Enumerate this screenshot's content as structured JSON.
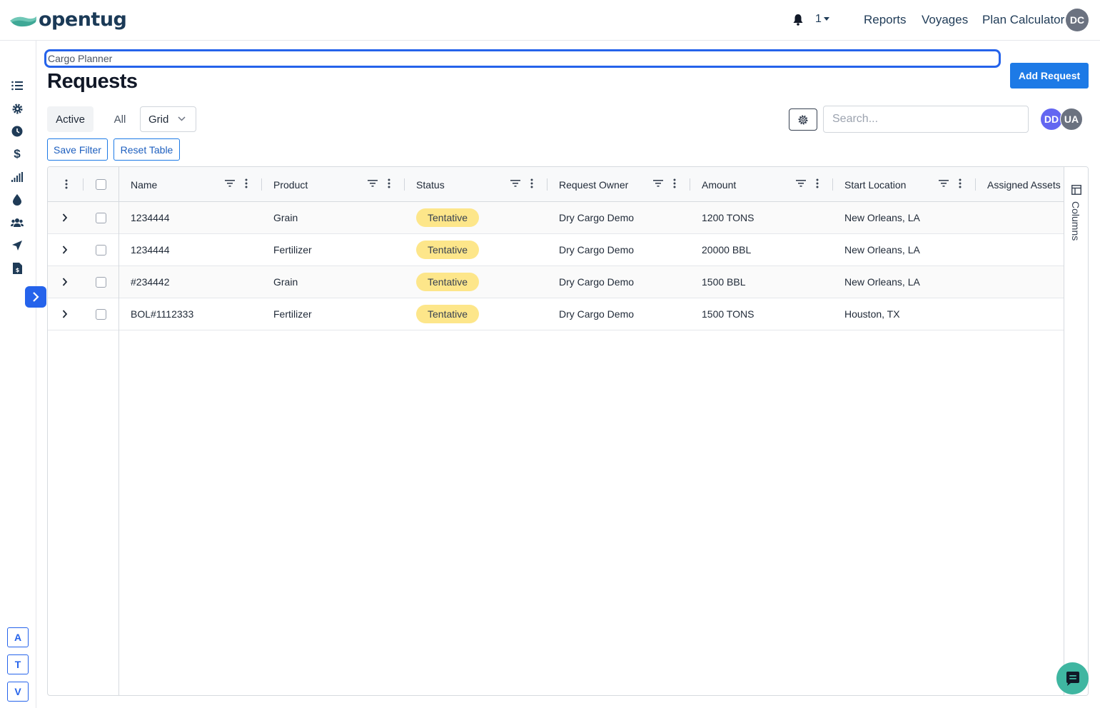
{
  "app": {
    "logo_text": "opentug",
    "brand_color": "#1b3a57",
    "accent_color": "#2563eb"
  },
  "topnav": {
    "notification_count": "1",
    "links": [
      "Reports",
      "Voyages",
      "Plan Calculator"
    ],
    "user_initials": "DC"
  },
  "sidebar": {
    "icons": [
      "list-icon",
      "gear-icon",
      "clock-icon",
      "dollar-icon",
      "signal-bars-icon",
      "drop-icon",
      "users-icon",
      "navigation-arrow-icon",
      "invoice-icon"
    ],
    "expand_icon": "chevron-right-icon",
    "letter_buttons": [
      "A",
      "T",
      "V"
    ]
  },
  "page": {
    "breadcrumb": "Cargo Planner",
    "title": "Requests",
    "add_button": "Add Request"
  },
  "toolbar": {
    "tab_active": "Active",
    "tab_all": "All",
    "view_select": "Grid",
    "search_placeholder": "Search...",
    "avatars": [
      {
        "initials": "DD",
        "color": "#6366f1"
      },
      {
        "initials": "UA",
        "color": "#6b7280"
      }
    ],
    "save_filter": "Save Filter",
    "reset_table": "Reset Table"
  },
  "grid": {
    "columns": [
      "Name",
      "Product",
      "Status",
      "Request Owner",
      "Amount",
      "Start Location",
      "Assigned Assets"
    ],
    "rows": [
      {
        "name": "1234444",
        "product": "Grain",
        "status": "Tentative",
        "owner": "Dry Cargo Demo",
        "amount": "1200 TONS",
        "start_location": "New Orleans, LA"
      },
      {
        "name": "1234444",
        "product": "Fertilizer",
        "status": "Tentative",
        "owner": "Dry Cargo Demo",
        "amount": "20000 BBL",
        "start_location": "New Orleans, LA"
      },
      {
        "name": "#234442",
        "product": "Grain",
        "status": "Tentative",
        "owner": "Dry Cargo Demo",
        "amount": "1500 BBL",
        "start_location": "New Orleans, LA"
      },
      {
        "name": "BOL#1112333",
        "product": "Fertilizer",
        "status": "Tentative",
        "owner": "Dry Cargo Demo",
        "amount": "1500 TONS",
        "start_location": "Houston, TX"
      }
    ],
    "side_panel_label": "Columns",
    "status_color": "#fde68a"
  }
}
